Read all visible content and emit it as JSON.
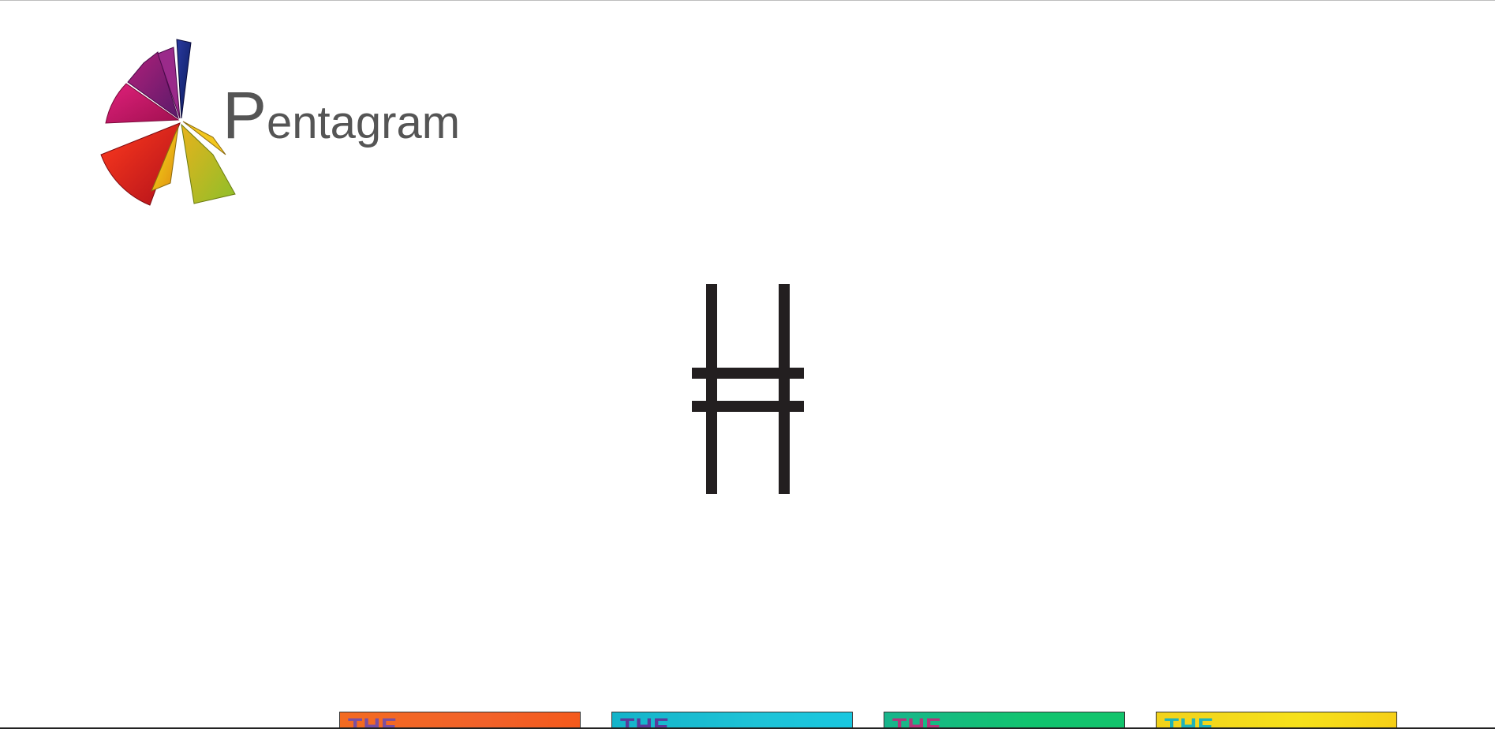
{
  "brand": {
    "logo_initial": "P",
    "logo_rest": "entagram",
    "logo_text_color": "#555555"
  },
  "hero": {
    "glyph_icon": "double-bar-h-icon",
    "glyph_color": "#231f20"
  },
  "thumbnails": [
    {
      "label": "THE",
      "accent": "#f36b21"
    },
    {
      "label": "THE",
      "accent": "#1ec3d7"
    },
    {
      "label": "THE",
      "accent": "#11c46f"
    },
    {
      "label": "THE",
      "accent": "#f6e11b"
    }
  ]
}
